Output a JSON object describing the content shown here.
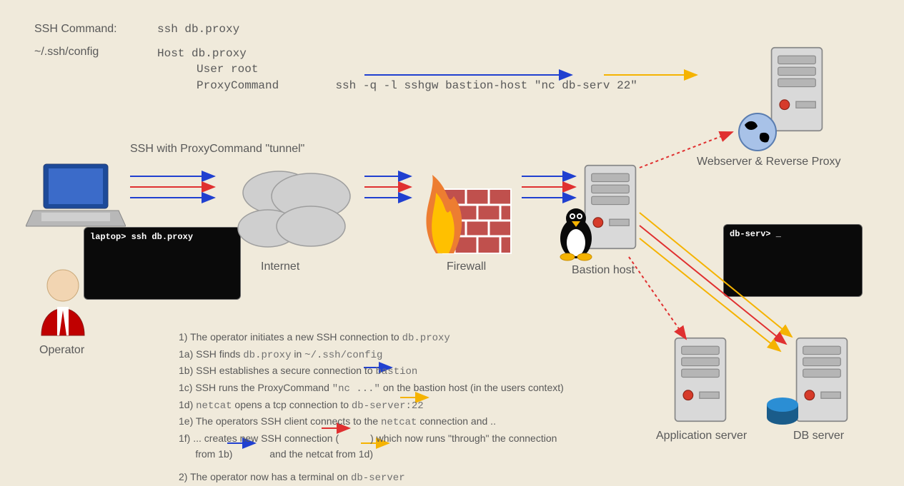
{
  "header": {
    "ssh_command_label": "SSH Command:",
    "ssh_command_value": "ssh db.proxy",
    "config_path": "~/.ssh/config",
    "config_line1": "Host db.proxy",
    "config_line2": "User root",
    "config_line3a": "ProxyCommand",
    "config_line3b": "ssh  -q -l sshgw bastion-host \"nc db-serv 22\""
  },
  "tunnel_label": "SSH with ProxyCommand \"tunnel\"",
  "nodes": {
    "operator": "Operator",
    "internet": "Internet",
    "firewall": "Firewall",
    "bastion": "Bastion host",
    "webserver": "Webserver & Reverse Proxy",
    "appserver": "Application server",
    "dbserver": "DB server"
  },
  "terminals": {
    "laptop": "laptop> ssh db.proxy",
    "dbserv": "db-serv> _"
  },
  "steps": {
    "s1": "1) The operator initiates a new SSH connection to ",
    "s1m": "db.proxy",
    "s1a": "1a) SSH finds ",
    "s1a_m1": "db.proxy",
    "s1a_mid": " in ",
    "s1a_m2": "~/.ssh/config",
    "s1b": "1b) SSH establishes a secure connection to ",
    "s1b_m": "bastion",
    "s1c": "1c) SSH runs the ProxyCommand ",
    "s1c_m": "\"nc ...\"",
    "s1c_tail": "  on the bastion host (in the users context)",
    "s1d": "1d) ",
    "s1d_m1": "netcat",
    "s1d_mid": " opens a tcp connection to ",
    "s1d_m2": "db-server:22",
    "s1e": "1e) The operators SSH client connects to the ",
    "s1e_m": "netcat",
    "s1e_tail": " connection and ..",
    "s1f": "1f) ... creates new SSH connection (",
    "s1f_mid": ") which now runs \"through\" the connection",
    "s1f2": "      from 1b) ",
    "s1f2_mid": " and the netcat from 1d) ",
    "s2": "2) The operator now has a terminal on ",
    "s2_m": "db-server"
  }
}
